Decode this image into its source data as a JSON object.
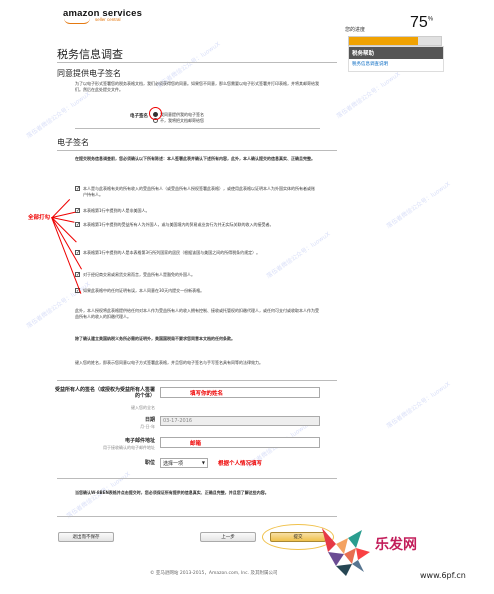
{
  "header": {
    "logo_text": "amazon services",
    "logo_sub": "seller central"
  },
  "progress": {
    "label": "您的进度",
    "percent_text": "75",
    "percent_sign": "%",
    "value": 0.75,
    "color": "#f0a202"
  },
  "help": {
    "title": "税务帮助",
    "link": "税务信息调查说明"
  },
  "page_title": "税务信息调查",
  "consent": {
    "title": "同意提供电子签名",
    "intro": "为了以电子形式签署您的税务表格文档，我们必须获得您的同意。如果您不同意，那么您需要以电子形式签署并打印表格，并将其邮寄给我们。然后在此处提交文件。",
    "label": "电子签名",
    "options": [
      "我同意提供我的电子签名",
      "不，我将把文档邮寄给您"
    ]
  },
  "esign": {
    "title": "电子签名",
    "intro": "在提交税务信息调查前，您必须确认以下所有陈述：本人签署此表并确认下述所有内容，此外，本人确认提交的信息真实、正确且完整。",
    "items": [
      "本人是与此表格有关的所有收入的受益所有人（或受益所有人授权签署此表格），或使用此表格以证明本人为外国实体的所有者或账户持有人。",
      "本表格第1行中提到的人是非美国人。",
      "本表格第1行中提到的受益所有人为外国人，或与美国境内的贸易或业务行为并无实际关联的收入的接受者。",
      "本表格第1行中提到的人是本表格第3行所列国家的居民（根据该国与美国之间的所得税条约规定）。",
      "对于经纪商交易或易货交易而言，受益所有人是豁免的外国人。",
      "如果此表格中的任何证明有误，本人同意在30天内提交一份新表格。"
    ],
    "annotation": "全部打勾",
    "note": "此外，本人授权将此表格提供给任何对本人作为受益所有人的收入拥有控制、接收或托管权的扣缴代理人，或任何可支付或收取本人作为受益所有人的收入的扣缴代理人。",
    "irs_note": "除了确认建立美国纳税义务所必需的证明外，美国国税局不要求您同意本文档的任何条款。",
    "instruction": "键入您的姓名，即表示您同意以电子方式签署此表格，并且您的电子签名与手写签名具有同等的法律效力。"
  },
  "form": {
    "name_label": "受益所有人的签名（或授权为受益所有人签署的个体）",
    "name_hint": "键入您的全名",
    "name_annotation": "填写你的姓名",
    "date_label": "日期",
    "date_hint": "月-日-年",
    "date_value": "03-17-2016",
    "email_label": "电子邮件地址",
    "email_hint": "用于接收确认的电子邮件地址",
    "email_annotation": "邮箱",
    "role_label": "职位",
    "role_value": "选择一项",
    "role_annotation": "根据个人情况填写"
  },
  "consent_notice": "当您确认W-8BEN表格并点击提交时，您必须保证所有提供的信息真实、正确且完整，并且您了解这些内容。",
  "buttons": {
    "save_exit": "退出而不保存",
    "previous": "上一步",
    "submit": "提交"
  },
  "footer": "© 亚马逊网站 2013-2015，Amazon.com, Inc. 及其附属公司",
  "brand": {
    "name": "乐发网",
    "url": "www.6pf.cn"
  },
  "watermark": "落伍者微信公众号：luowuX"
}
